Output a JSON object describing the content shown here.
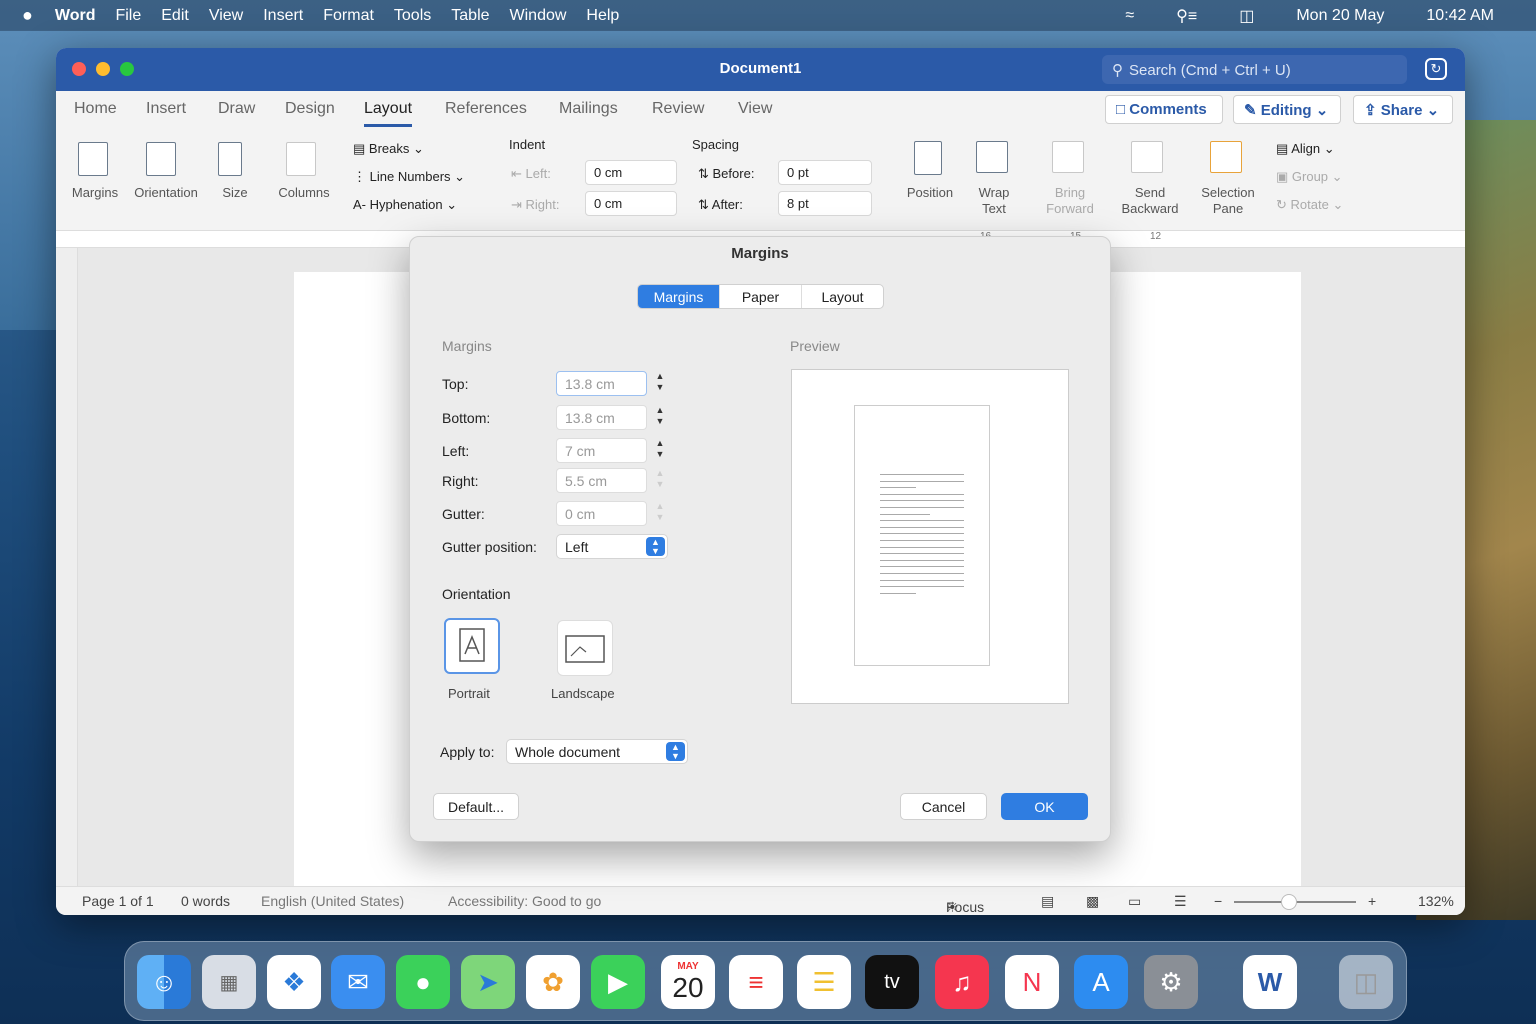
{
  "menubar": {
    "apple": "",
    "app": "Word",
    "items": [
      "File",
      "Edit",
      "View",
      "Insert",
      "Format",
      "Tools",
      "Table",
      "Window",
      "Help"
    ],
    "date": "Mon 20 May",
    "time": "10:42 AM"
  },
  "window": {
    "title": "Document1",
    "search_placeholder": "Search (Cmd + Ctrl + U)"
  },
  "ribbon": {
    "tabs": [
      "Home",
      "Insert",
      "Draw",
      "Design",
      "Layout",
      "References",
      "Mailings",
      "Review",
      "View"
    ],
    "active_tab": "Layout",
    "comments": "Comments",
    "editing": "Editing",
    "share": "Share",
    "groups": {
      "margins": "Margins",
      "orientation": "Orientation",
      "size": "Size",
      "columns": "Columns",
      "breaks": "Breaks",
      "line_numbers": "Line Numbers",
      "hyphenation": "Hyphenation",
      "indent": "Indent",
      "indent_left_label": "Left:",
      "indent_left": "0 cm",
      "indent_right_label": "Right:",
      "indent_right": "0 cm",
      "spacing": "Spacing",
      "before_label": "Before:",
      "before": "0 pt",
      "after_label": "After:",
      "after": "8 pt",
      "position": "Position",
      "wrap_text_1": "Wrap",
      "wrap_text_2": "Text",
      "bring_forward_1": "Bring",
      "bring_forward_2": "Forward",
      "send_backward_1": "Send",
      "send_backward_2": "Backward",
      "selection_pane_1": "Selection",
      "selection_pane_2": "Pane",
      "align": "Align",
      "group": "Group",
      "rotate": "Rotate"
    }
  },
  "ruler": {
    "marks": [
      "16",
      "15",
      "12"
    ]
  },
  "status": {
    "page": "Page 1 of 1",
    "words": "0 words",
    "language": "English (United States)",
    "accessibility": "Accessibility: Good to go",
    "focus": "Focus",
    "zoom": "132%",
    "zoom_level": 0.45
  },
  "dialog": {
    "title": "Margins",
    "tabs": [
      "Margins",
      "Paper",
      "Layout"
    ],
    "active_tab": "Margins",
    "section_margins": "Margins",
    "section_preview": "Preview",
    "top_label": "Top:",
    "top": "13.8 cm",
    "bottom_label": "Bottom:",
    "bottom": "13.8 cm",
    "left_label": "Left:",
    "left": "7 cm",
    "right_label": "Right:",
    "right": "5.5 cm",
    "gutter_label": "Gutter:",
    "gutter": "0 cm",
    "gutter_position_label": "Gutter position:",
    "gutter_position": "Left",
    "orientation_label": "Orientation",
    "portrait": "Portrait",
    "landscape": "Landscape",
    "apply_to_label": "Apply to:",
    "apply_to": "Whole document",
    "default_button": "Default...",
    "cancel_button": "Cancel",
    "ok_button": "OK"
  },
  "dock": {
    "calendar_month": "MAY",
    "calendar_day": "20",
    "tv_label": "tv",
    "apps": [
      "finder-icon",
      "launchpad-icon",
      "safari-icon",
      "mail-icon",
      "messages-icon",
      "maps-icon",
      "photos-icon",
      "facetime-icon",
      "calendar-icon",
      "reminders-icon",
      "notes-icon",
      "apple-tv-icon",
      "music-icon",
      "news-icon",
      "app-store-icon",
      "system-preferences-icon",
      "word-icon",
      "trash-icon"
    ]
  }
}
